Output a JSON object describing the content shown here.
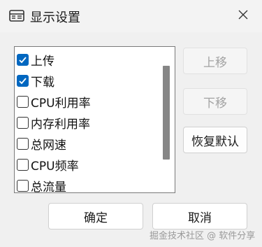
{
  "window": {
    "title": "显示设置",
    "icon": "window-grid-icon",
    "close_icon": "close-icon"
  },
  "list": {
    "items": [
      {
        "label": "上传",
        "checked": true
      },
      {
        "label": "下载",
        "checked": true
      },
      {
        "label": "CPU利用率",
        "checked": false
      },
      {
        "label": "内存利用率",
        "checked": false
      },
      {
        "label": "总网速",
        "checked": false
      },
      {
        "label": "CPU频率",
        "checked": false
      },
      {
        "label": "总流量",
        "checked": false
      }
    ]
  },
  "buttons": {
    "move_up": "上移",
    "move_down": "下移",
    "restore_default": "恢复默认",
    "ok": "确定",
    "cancel": "取消"
  },
  "watermark": "掘金技术社区 @ 软件分享",
  "colors": {
    "accent": "#0067c0",
    "background": "#f0f0f0"
  }
}
